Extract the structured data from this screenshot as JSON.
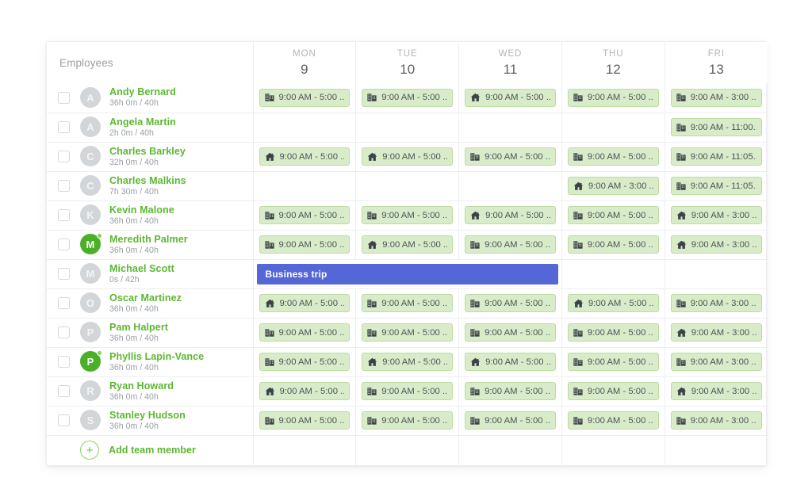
{
  "theme": {
    "accent_green": "#5cb832",
    "chip_bg": "#d9ecc9",
    "chip_border": "#bcdca2",
    "event_blue": "#5566d6",
    "avatar_grey": "#d3d6d9",
    "avatar_green": "#4caf28",
    "text_muted": "#9aa0a6"
  },
  "header": {
    "employees_label": "Employees",
    "days": [
      {
        "dow": "MON",
        "num": "9"
      },
      {
        "dow": "TUE",
        "num": "10"
      },
      {
        "dow": "WED",
        "num": "11"
      },
      {
        "dow": "THU",
        "num": "12"
      },
      {
        "dow": "FRI",
        "num": "13"
      }
    ]
  },
  "add_row": {
    "icon": "plus-icon",
    "label": "Add team member"
  },
  "rows": [
    {
      "name": "Andy Bernard",
      "hours": "36h 0m / 40h",
      "initial": "A",
      "avatar_style": "grey",
      "online": false,
      "shifts": [
        {
          "icon": "office-icon",
          "label": "9:00 AM - 5:00 ..."
        },
        {
          "icon": "office-icon",
          "label": "9:00 AM - 5:00 ..."
        },
        {
          "icon": "home-icon",
          "label": "9:00 AM - 5:00 ..."
        },
        {
          "icon": "office-icon",
          "label": "9:00 AM - 5:00 ..."
        },
        {
          "icon": "office-icon",
          "label": "9:00 AM - 3:00 ..."
        }
      ]
    },
    {
      "name": "Angela Martin",
      "hours": "2h 0m / 40h",
      "initial": "A",
      "avatar_style": "grey",
      "online": false,
      "shifts": [
        null,
        null,
        null,
        null,
        {
          "icon": "office-icon",
          "label": "9:00 AM - 11:00..."
        }
      ]
    },
    {
      "name": "Charles Barkley",
      "hours": "32h 0m / 40h",
      "initial": "C",
      "avatar_style": "grey",
      "online": false,
      "shifts": [
        {
          "icon": "home-icon",
          "label": "9:00 AM - 5:00 ..."
        },
        {
          "icon": "home-icon",
          "label": "9:00 AM - 5:00 ..."
        },
        {
          "icon": "office-icon",
          "label": "9:00 AM - 5:00 ..."
        },
        {
          "icon": "office-icon",
          "label": "9:00 AM - 5:00 ..."
        },
        {
          "icon": "office-icon",
          "label": "9:00 AM - 11:05..."
        }
      ]
    },
    {
      "name": "Charles Malkins",
      "hours": "7h 30m / 40h",
      "initial": "C",
      "avatar_style": "grey",
      "online": false,
      "shifts": [
        null,
        null,
        null,
        {
          "icon": "home-icon",
          "label": "9:00 AM - 3:00 ..."
        },
        {
          "icon": "office-icon",
          "label": "9:00 AM - 11:05..."
        }
      ]
    },
    {
      "name": "Kevin Malone",
      "hours": "36h 0m / 40h",
      "initial": "K",
      "avatar_style": "grey",
      "online": false,
      "shifts": [
        {
          "icon": "office-icon",
          "label": "9:00 AM - 5:00 ..."
        },
        {
          "icon": "office-icon",
          "label": "9:00 AM - 5:00 ..."
        },
        {
          "icon": "home-icon",
          "label": "9:00 AM - 5:00 ..."
        },
        {
          "icon": "office-icon",
          "label": "9:00 AM - 5:00 ..."
        },
        {
          "icon": "home-icon",
          "label": "9:00 AM - 3:00 ..."
        }
      ]
    },
    {
      "name": "Meredith Palmer",
      "hours": "36h 0m / 40h",
      "initial": "M",
      "avatar_style": "green",
      "online": true,
      "shifts": [
        {
          "icon": "office-icon",
          "label": "9:00 AM - 5:00 ..."
        },
        {
          "icon": "home-icon",
          "label": "9:00 AM - 5:00 ..."
        },
        {
          "icon": "office-icon",
          "label": "9:00 AM - 5:00 ..."
        },
        {
          "icon": "office-icon",
          "label": "9:00 AM - 5:00 ..."
        },
        {
          "icon": "home-icon",
          "label": "9:00 AM - 3:00 ..."
        }
      ]
    },
    {
      "name": "Michael Scott",
      "hours": "0s / 42h",
      "initial": "M",
      "avatar_style": "grey",
      "online": false,
      "event": {
        "label": "Business trip",
        "color": "#5566d6",
        "start_day": 0,
        "span_days": 3
      },
      "shifts": [
        null,
        null,
        null,
        null,
        null
      ]
    },
    {
      "name": "Oscar Martinez",
      "hours": "36h 0m / 40h",
      "initial": "O",
      "avatar_style": "grey",
      "online": false,
      "shifts": [
        {
          "icon": "home-icon",
          "label": "9:00 AM - 5:00 ..."
        },
        {
          "icon": "office-icon",
          "label": "9:00 AM - 5:00 ..."
        },
        {
          "icon": "office-icon",
          "label": "9:00 AM - 5:00 ..."
        },
        {
          "icon": "home-icon",
          "label": "9:00 AM - 5:00 ..."
        },
        {
          "icon": "office-icon",
          "label": "9:00 AM - 3:00 ..."
        }
      ]
    },
    {
      "name": "Pam Halpert",
      "hours": "36h 0m / 40h",
      "initial": "P",
      "avatar_style": "grey",
      "online": false,
      "shifts": [
        {
          "icon": "office-icon",
          "label": "9:00 AM - 5:00 ..."
        },
        {
          "icon": "office-icon",
          "label": "9:00 AM - 5:00 ..."
        },
        {
          "icon": "office-icon",
          "label": "9:00 AM - 5:00 ..."
        },
        {
          "icon": "office-icon",
          "label": "9:00 AM - 5:00 ..."
        },
        {
          "icon": "home-icon",
          "label": "9:00 AM - 3:00 ..."
        }
      ]
    },
    {
      "name": "Phyllis Lapin-Vance",
      "hours": "36h 0m / 40h",
      "initial": "P",
      "avatar_style": "green",
      "online": true,
      "shifts": [
        {
          "icon": "office-icon",
          "label": "9:00 AM - 5:00 ..."
        },
        {
          "icon": "home-icon",
          "label": "9:00 AM - 5:00 ..."
        },
        {
          "icon": "home-icon",
          "label": "9:00 AM - 5:00 ..."
        },
        {
          "icon": "office-icon",
          "label": "9:00 AM - 5:00 ..."
        },
        {
          "icon": "office-icon",
          "label": "9:00 AM - 3:00 ..."
        }
      ]
    },
    {
      "name": "Ryan Howard",
      "hours": "36h 0m / 40h",
      "initial": "R",
      "avatar_style": "grey",
      "online": false,
      "shifts": [
        {
          "icon": "home-icon",
          "label": "9:00 AM - 5:00 ..."
        },
        {
          "icon": "office-icon",
          "label": "9:00 AM - 5:00 ..."
        },
        {
          "icon": "office-icon",
          "label": "9:00 AM - 5:00 ..."
        },
        {
          "icon": "office-icon",
          "label": "9:00 AM - 5:00 ..."
        },
        {
          "icon": "home-icon",
          "label": "9:00 AM - 3:00 ..."
        }
      ]
    },
    {
      "name": "Stanley Hudson",
      "hours": "36h 0m / 40h",
      "initial": "S",
      "avatar_style": "grey",
      "online": false,
      "shifts": [
        {
          "icon": "office-icon",
          "label": "9:00 AM - 5:00 ..."
        },
        {
          "icon": "office-icon",
          "label": "9:00 AM - 5:00 ..."
        },
        {
          "icon": "office-icon",
          "label": "9:00 AM - 5:00 ..."
        },
        {
          "icon": "office-icon",
          "label": "9:00 AM - 5:00 ..."
        },
        {
          "icon": "office-icon",
          "label": "9:00 AM - 3:00 ..."
        }
      ]
    }
  ]
}
